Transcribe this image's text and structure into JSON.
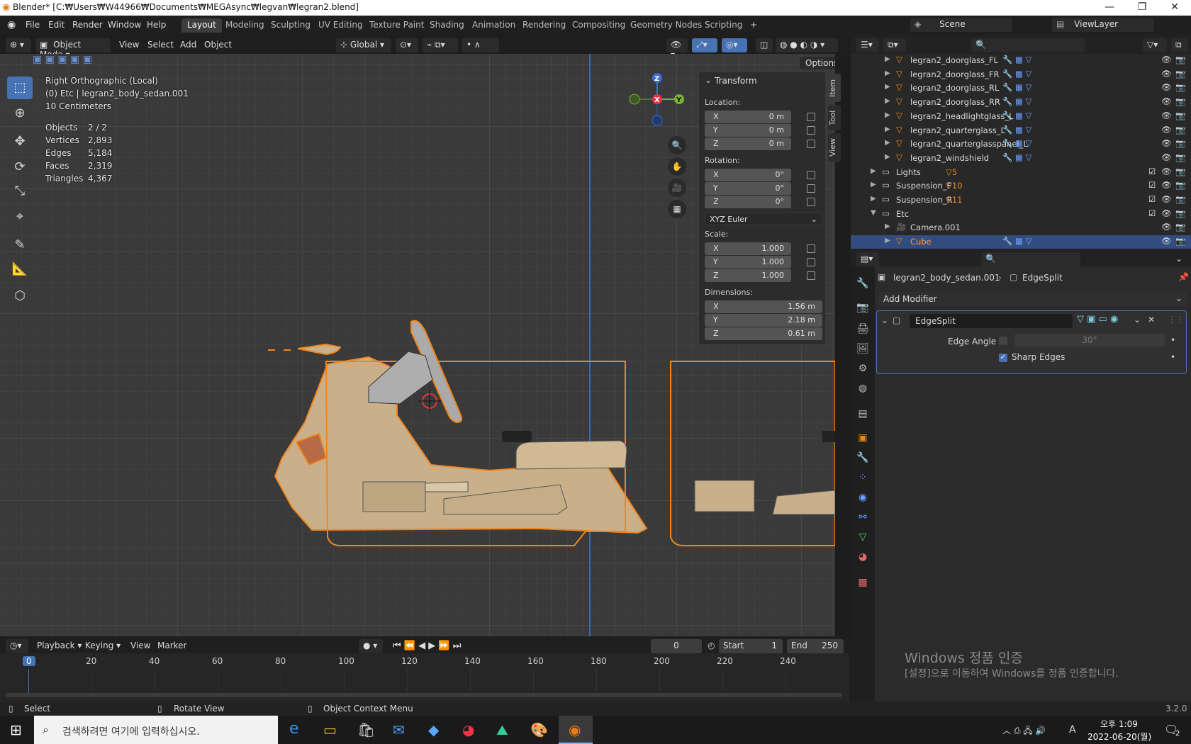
{
  "window": {
    "title": "Blender* [C:₩Users₩W44966₩Documents₩MEGAsync₩legvan₩legran2.blend]",
    "min": "—",
    "max": "❐",
    "close": "✕"
  },
  "menus": [
    "File",
    "Edit",
    "Render",
    "Window",
    "Help"
  ],
  "workspaces": [
    "Layout",
    "Modeling",
    "Sculpting",
    "UV Editing",
    "Texture Paint",
    "Shading",
    "Animation",
    "Rendering",
    "Compositing",
    "Geometry Nodes",
    "Scripting"
  ],
  "workspace_add": "+",
  "scene": {
    "name": "Scene",
    "viewlayer": "ViewLayer"
  },
  "viewport_header": {
    "mode": "Object Mode",
    "menus": [
      "View",
      "Select",
      "Add",
      "Object"
    ],
    "orientation": "Global",
    "options": "Options"
  },
  "overlay": {
    "view_name": "Right Orthographic (Local)",
    "collection": "(0) Etc | legran2_body_sedan.001",
    "scale": "10 Centimeters",
    "stats": [
      {
        "label": "Objects",
        "value": "2 / 2"
      },
      {
        "label": "Vertices",
        "value": "2,893"
      },
      {
        "label": "Edges",
        "value": "5,184"
      },
      {
        "label": "Faces",
        "value": "2,319"
      },
      {
        "label": "Triangles",
        "value": "4,367"
      }
    ]
  },
  "gizmo": {
    "z": "Z",
    "x": "X",
    "y": "Y"
  },
  "npanel": {
    "tabs": [
      "Item",
      "Tool",
      "View"
    ],
    "header": "Transform",
    "location_label": "Location:",
    "location": [
      {
        "ax": "X",
        "v": "0 m"
      },
      {
        "ax": "Y",
        "v": "0 m"
      },
      {
        "ax": "Z",
        "v": "0 m"
      }
    ],
    "rotation_label": "Rotation:",
    "rotation": [
      {
        "ax": "X",
        "v": "0°"
      },
      {
        "ax": "Y",
        "v": "0°"
      },
      {
        "ax": "Z",
        "v": "0°"
      }
    ],
    "rotation_mode": "XYZ Euler",
    "scale_label": "Scale:",
    "scale": [
      {
        "ax": "X",
        "v": "1.000"
      },
      {
        "ax": "Y",
        "v": "1.000"
      },
      {
        "ax": "Z",
        "v": "1.000"
      }
    ],
    "dimensions_label": "Dimensions:",
    "dimensions": [
      {
        "ax": "X",
        "v": "1.56 m"
      },
      {
        "ax": "Y",
        "v": "2.18 m"
      },
      {
        "ax": "Z",
        "v": "0.61 m"
      }
    ]
  },
  "outliner": [
    {
      "name": "legran2_doorglass_FL",
      "type": "mesh",
      "indent": 2
    },
    {
      "name": "legran2_doorglass_FR",
      "type": "mesh",
      "indent": 2
    },
    {
      "name": "legran2_doorglass_RL",
      "type": "mesh",
      "indent": 2
    },
    {
      "name": "legran2_doorglass_RR",
      "type": "mesh",
      "indent": 2
    },
    {
      "name": "legran2_headlightglass_L",
      "type": "mesh",
      "indent": 2
    },
    {
      "name": "legran2_quarterglass_L",
      "type": "mesh",
      "indent": 2
    },
    {
      "name": "legran2_quarterglasspanel_L",
      "type": "mesh",
      "indent": 2
    },
    {
      "name": "legran2_windshield",
      "type": "mesh",
      "indent": 2
    },
    {
      "name": "Lights",
      "type": "collection",
      "indent": 1,
      "badge": "5"
    },
    {
      "name": "Suspension_F",
      "type": "collection",
      "indent": 1,
      "badge": "10"
    },
    {
      "name": "Suspension_R",
      "type": "collection",
      "indent": 1,
      "badge": "11"
    },
    {
      "name": "Etc",
      "type": "collection",
      "indent": 1,
      "expanded": true
    },
    {
      "name": "Camera.001",
      "type": "camera",
      "indent": 2
    },
    {
      "name": "Cube",
      "type": "mesh",
      "indent": 2,
      "selected": true
    }
  ],
  "properties": {
    "object": "legran2_body_sedan.001",
    "modifier_crumb": "EdgeSplit",
    "add_modifier": "Add Modifier",
    "modifier_name": "EdgeSplit",
    "edge_angle_label": "Edge Angle",
    "edge_angle_value": "30°",
    "sharp_edges_label": "Sharp Edges"
  },
  "timeline": {
    "menus": [
      "Playback",
      "Keying",
      "View",
      "Marker"
    ],
    "current": "0",
    "start_label": "Start",
    "start": "1",
    "end_label": "End",
    "end": "250",
    "ticks": [
      "0",
      "20",
      "40",
      "60",
      "80",
      "100",
      "120",
      "140",
      "160",
      "180",
      "200",
      "220",
      "240"
    ]
  },
  "watermark": {
    "line1": "Windows 정품 인증",
    "line2": "[설정]으로 이동하여 Windows를 정품 인증합니다."
  },
  "statusbar": {
    "select": "Select",
    "rotate": "Rotate View",
    "context": "Object Context Menu",
    "version": "3.2.0"
  },
  "taskbar": {
    "search_placeholder": "검색하려면 여기에 입력하십시오.",
    "time": "오후 1:09",
    "date": "2022-06-20(월)",
    "lang": "A",
    "notif": "2"
  },
  "colors": {
    "accent": "#4772b3",
    "selection": "#f0851d",
    "active_tab": "#3d3d3d"
  }
}
